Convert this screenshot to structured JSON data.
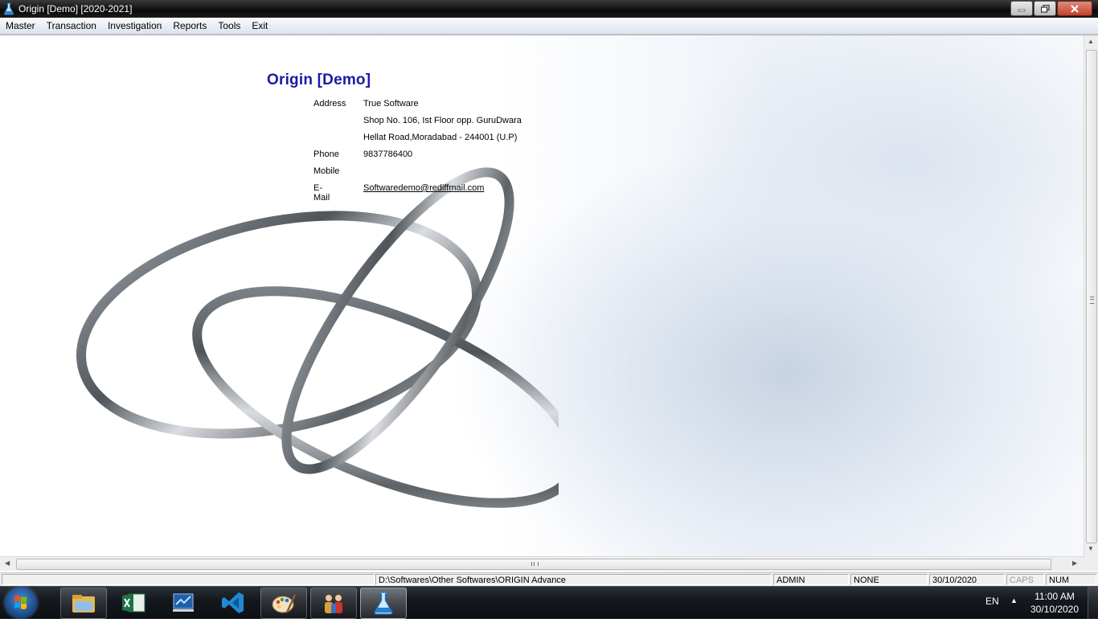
{
  "window": {
    "title": "Origin [Demo] [2020-2021]"
  },
  "menu": [
    "Master",
    "Transaction",
    "Investigation",
    "Reports",
    "Tools",
    "Exit"
  ],
  "company": {
    "name": "Origin [Demo]",
    "address_label": "Address",
    "address_line1": "True Software",
    "address_line2": "Shop No. 106, Ist Floor opp. GuruDwara",
    "address_line3": "Hellat Road,Moradabad - 244001 (U.P)",
    "phone_label": "Phone",
    "phone": "9837786400",
    "mobile_label": "Mobile",
    "mobile": "",
    "email_label": "E-Mail",
    "email": "Softwaredemo@rediffmail.com"
  },
  "statusbar": {
    "path": "D:\\Softwares\\Other Softwares\\ORIGIN Advance",
    "user": "ADMIN",
    "mode": "NONE",
    "date": "30/10/2020",
    "caps": "CAPS",
    "num": "NUM"
  },
  "taskbar": {
    "apps": [
      "file-explorer-icon",
      "excel-icon",
      "monitor-app-icon",
      "vscode-icon",
      "paint-icon",
      "users-app-icon",
      "flask-app-icon"
    ],
    "language": "EN",
    "time": "11:00 AM",
    "date": "30/10/2020"
  },
  "colors": {
    "company_title": "#1a1aa6",
    "titlebar": "#0b0b0b",
    "taskbar": "#15191f"
  }
}
